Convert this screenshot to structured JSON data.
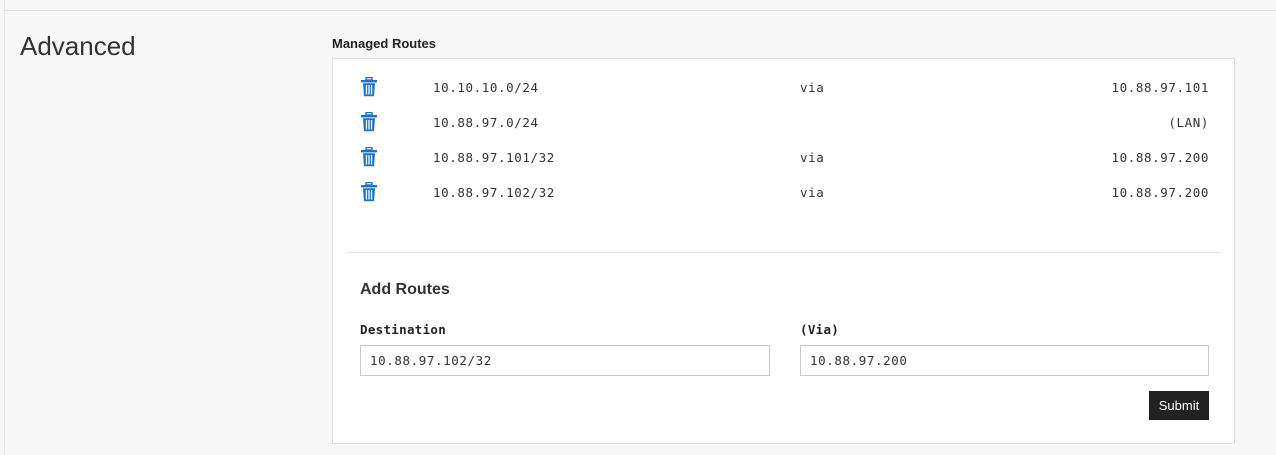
{
  "section": {
    "title": "Advanced"
  },
  "managed_routes": {
    "heading": "Managed Routes",
    "routes": [
      {
        "destination": "10.10.10.0/24",
        "via_label": "via",
        "gateway": "10.88.97.101"
      },
      {
        "destination": "10.88.97.0/24",
        "via_label": "",
        "gateway": "(LAN)"
      },
      {
        "destination": "10.88.97.101/32",
        "via_label": "via",
        "gateway": "10.88.97.200"
      },
      {
        "destination": "10.88.97.102/32",
        "via_label": "via",
        "gateway": "10.88.97.200"
      }
    ]
  },
  "add_routes": {
    "title": "Add Routes",
    "destination_label": "Destination",
    "destination_value": "10.88.97.102/32",
    "via_label": "(Via)",
    "via_value": "10.88.97.200",
    "submit_label": "Submit"
  },
  "icons": {
    "delete": "trash-icon"
  },
  "colors": {
    "trash_icon": "#1a73c8",
    "submit_bg": "#222222",
    "submit_text": "#ffffff",
    "page_bg": "#f7f7f7",
    "panel_bg": "#ffffff"
  }
}
